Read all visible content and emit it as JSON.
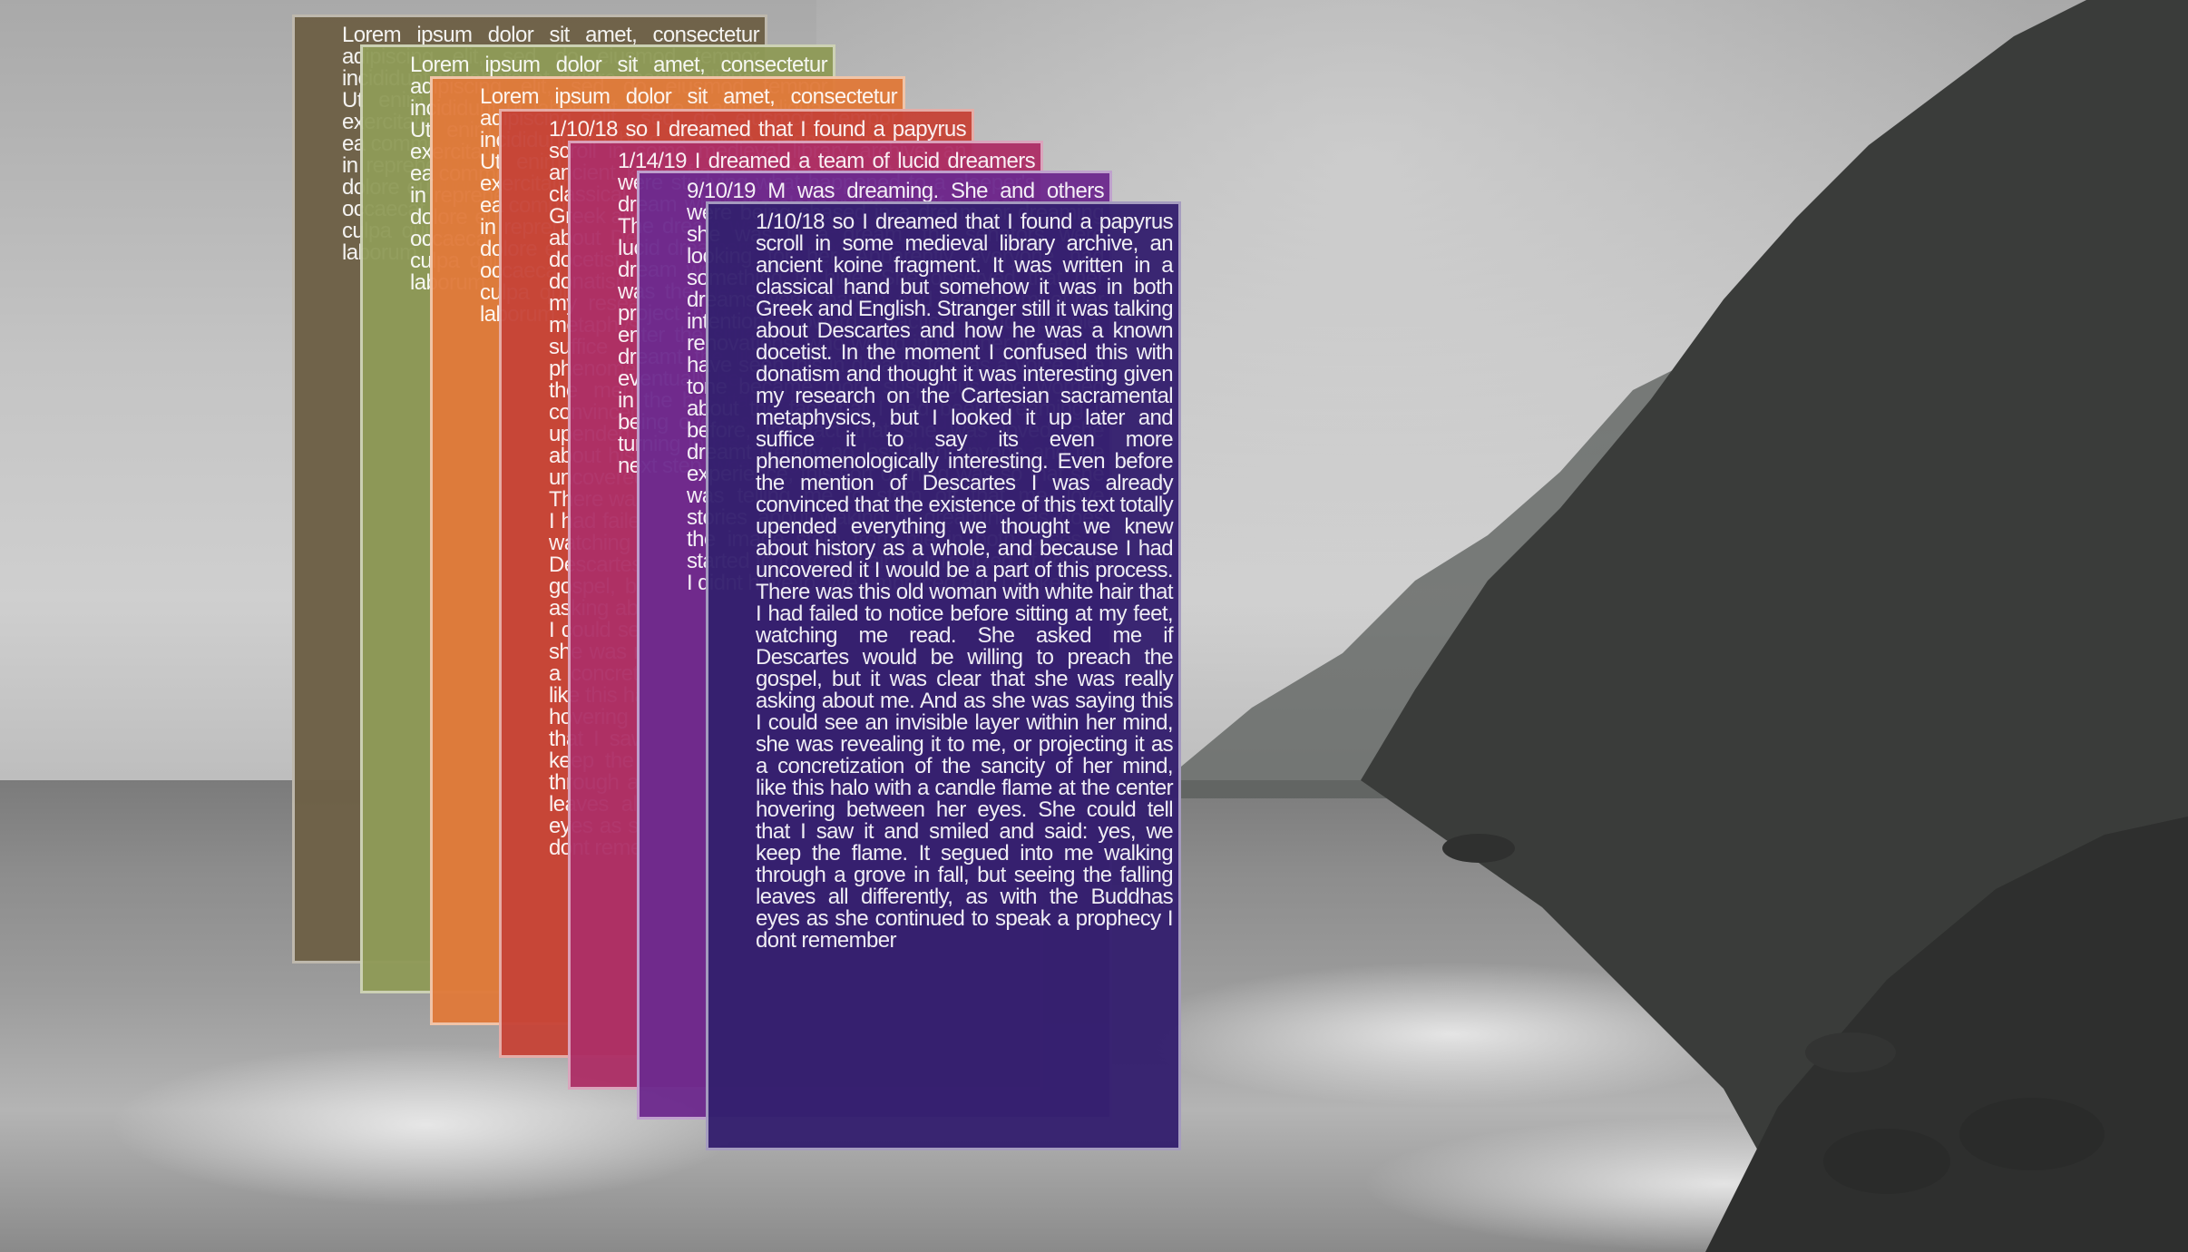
{
  "colors": {
    "card_1": "#6e6147",
    "card_2": "#8f9a57",
    "card_3": "#e07a3a",
    "card_4": "#c64437",
    "card_5": "#ad2f66",
    "card_6": "#6d2a8e",
    "card_7": "#35206e"
  },
  "cards": [
    {
      "text": "Lorem ipsum dolor sit amet, consectetur adipiscing elit, sed do eiusmod tempor incididunt ut labore et dolore magna aliqua. Ut enim ad minim veniam, quis nostrud exercitation ullamco laboris nisi ut aliquip ex ea commodo consequat. Duis aute irure dolor in reprehenderit in voluptate velit esse cillum dolore eu fugiat nulla pariatur. Excepteur sint occaecat cupidatat non proident, sunt in culpa qui officia deserunt mollit anim id est laborum."
    },
    {
      "text": "Lorem ipsum dolor sit amet, consectetur adipiscing elit, sed do eiusmod tempor incididunt ut labore et dolore magna aliqua. Ut enim ad minim veniam, quis nostrud exercitation ullamco laboris nisi ut aliquip ex ea commodo consequat. Duis aute irure dolor in reprehenderit in voluptate velit esse cillum dolore eu fugiat nulla pariatur. Excepteur sint occaecat cupidatat non proident, sunt in culpa qui officia deserunt mollit anim id est laborum."
    },
    {
      "text": "Lorem ipsum dolor sit amet, consectetur adipiscing elit, sed do eiusmod tempor incididunt ut labore et dolore magna aliqua. Ut enim ad minim veniam, quis nostrud exercitation ullamco laboris nisi ut aliquip ex ea commodo consequat. Duis aute irure dolor in reprehenderit in voluptate velit esse cillum dolore eu fugiat nulla pariatur. Excepteur sint occaecat cupidatat non proident, sunt in culpa qui officia deserunt mollit anim id est laborum."
    },
    {
      "text": "1/10/18 so I dreamed that I found a papyrus scroll in some medieval library archive, an ancient koine fragment. It was written in a classical hand but somehow it was in both Greek and English. Stranger still it was talking about Descartes and how he was a known docetist. In the moment I confused this with donatism and thought it was interesting given my research on the Cartesian sacramental metaphysics, but I looked it up later and suffice it to say its even more phenomenologically interesting. Even before the mention of Descartes I was already convinced that the existence of this text totally upended everything we thought we knew about history as a whole, and because I had uncovered it I would be a part of this process. There was this old woman with white hair that I had failed to notice before sitting at my feet, watching me read. She asked me if Descartes would be willing to preach the gospel, but it was clear that she was really asking about me. And as she was saying this I could see an invisible layer within her mind, she was revealing it to me, or projecting it as a concretization of the sancity of her mind, like this halo with a candle flame at the center hovering between her eyes. She could tell that I saw it and smiled and said: yes, we keep the flame. It segued into me walking through a grove in fall, but seeing the falling leaves all differently, as with the Buddhas eyes as she continued to speak a prophecy I dont remember"
    },
    {
      "text": "1/14/19 I dreamed a team of lucid dreamers were studying what happened to a sleeper's dream when the sleeper dreamt of a dream. The dream was fairly dramatic. The team of lucid dreamers assumed the character in the dream would emerge from the dream but it was the sleeper who was to emerge. Their project had to have other team members enter the situation where the dreamers had dreamt the likelihood of a distant dreamer eventually becoming a lucid dreamer. He was in the hospital, being driven by a feeling of being overcast by forces he could not see, turning in his sleep as in my alarm woke me next step, what was left for me?"
    },
    {
      "text": "9/10/19 M was dreaming. She and others were being chased in a dream, or dreaming she was in a dream, the senators were looking for her. Apparently everyone had something to hide. She observed that her dreams were spanish, and she dreamt of her intentions toward practices and people, renovations, who would inhabit her dreams. I have seen this in dreams too, as a voice, the tone became more suspicious, too worried about the fact that I had been dreaming it before, the fact that she was loved, she dreamt literally no less than anyone and the experience, this sort of thing was so that she was telling me to stem off that me, love stories about waking or dreaming, as does the image stem from me in both cases. I started to try to explain, but realized of course I didnt have to. We embraced and I woke up"
    },
    {
      "text": "1/10/18 so I dreamed that I found a papyrus scroll in some medieval library archive, an ancient koine fragment. It was written in a classical hand but somehow it was in both Greek and English. Stranger still it was talking about Descartes and how he was a known docetist. In the moment I confused this with donatism and thought it was interesting given my research on the Cartesian sacramental metaphysics, but I looked it up later and suffice it to say its even more phenomenologically interesting. Even before the mention of Descartes I was already convinced that the existence of this text totally upended everything we thought we knew about history as a whole, and because I had uncovered it I would be a part of this process. There was this old woman with white hair that I had failed to notice before sitting at my feet, watching me read. She asked me if Descartes would be willing to preach the gospel, but it was clear that she was really asking about me. And as she was saying this I could see an invisible layer within her mind, she was revealing it to me, or projecting it as a concretization of the sancity of her mind, like this halo with a candle flame at the center hovering between her eyes. She could tell that I saw it and smiled and said: yes, we keep the flame. It segued into me walking through a grove in fall, but seeing the falling leaves all differently, as with the Buddhas eyes as she continued to speak a prophecy I dont remember"
    }
  ]
}
